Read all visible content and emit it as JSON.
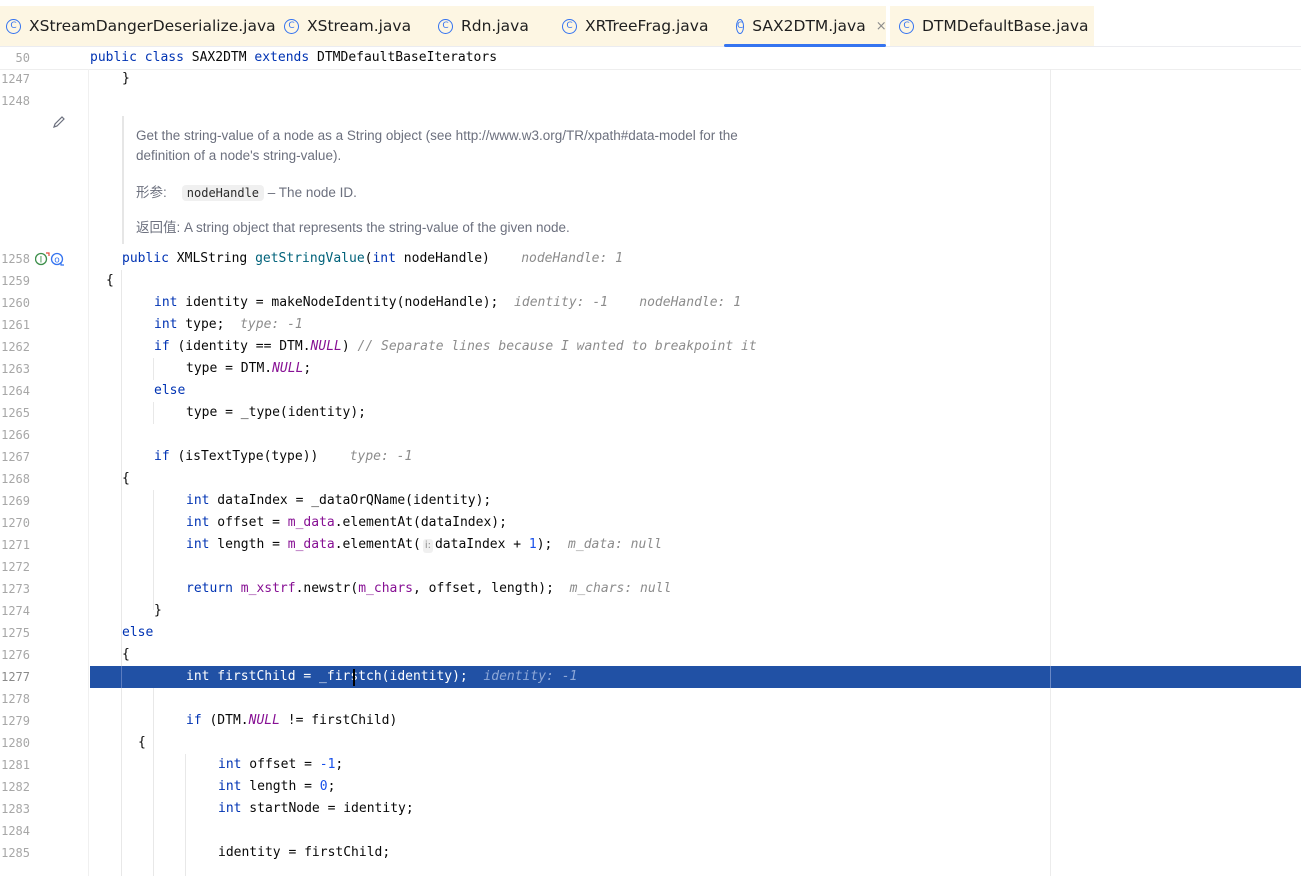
{
  "tabs": [
    {
      "label": "XStreamDangerDeserialize.java",
      "active": false
    },
    {
      "label": "XStream.java",
      "active": false
    },
    {
      "label": "Rdn.java",
      "active": false
    },
    {
      "label": "XRTreeFrag.java",
      "active": false
    },
    {
      "label": "SAX2DTM.java",
      "active": true
    },
    {
      "label": "DTMDefaultBase.java",
      "active": false
    }
  ],
  "close_glyph": "×",
  "sticky": {
    "line": "50",
    "public": "public",
    "class": "class",
    "name": "SAX2DTM",
    "extends": "extends",
    "parent": "DTMDefaultBaseIterators"
  },
  "doc": {
    "line1": "Get the string-value of a node as a String object (see http://www.w3.org/TR/xpath#data-model for the",
    "line2": "definition of a node's string-value).",
    "params_label": "形参:",
    "param_name": "nodeHandle",
    "param_desc": "– The node ID.",
    "returns_label": "返回值:",
    "returns_desc": "A string object that represents the string-value of the given node."
  },
  "lines": {
    "l1247": "1247",
    "l1248": "1248",
    "l1258": "1258",
    "l1259": "1259",
    "l1260": "1260",
    "l1261": "1261",
    "l1262": "1262",
    "l1263": "1263",
    "l1264": "1264",
    "l1265": "1265",
    "l1266": "1266",
    "l1267": "1267",
    "l1268": "1268",
    "l1269": "1269",
    "l1270": "1270",
    "l1271": "1271",
    "l1272": "1272",
    "l1273": "1273",
    "l1274": "1274",
    "l1275": "1275",
    "l1276": "1276",
    "l1277": "1277",
    "l1278": "1278",
    "l1279": "1279",
    "l1280": "1280",
    "l1281": "1281",
    "l1282": "1282",
    "l1283": "1283",
    "l1284": "1284",
    "l1285": "1285"
  },
  "code": {
    "c1247": "}",
    "c1258_pub": "public ",
    "c1258_type": "XMLString ",
    "c1258_fn": "getStringValue",
    "c1258_a": "(",
    "c1258_int": "int",
    "c1258_b": " nodeHandle)",
    "c1258_hint": "nodeHandle: 1",
    "c1259": "{",
    "c1260_int": "int",
    "c1260_a": " identity = makeNodeIdentity(nodeHandle);",
    "c1260_h1": "identity: -1",
    "c1260_h2": "nodeHandle: 1",
    "c1261_int": "int",
    "c1261_a": " type;",
    "c1261_h": "type: -1",
    "c1262_if": "if",
    "c1262_a": " (identity == DTM.",
    "c1262_null": "NULL",
    "c1262_b": ") ",
    "c1262_cmt": "// Separate lines because I wanted to breakpoint it",
    "c1263_a": "type = DTM.",
    "c1263_null": "NULL",
    "c1263_b": ";",
    "c1264": "else",
    "c1265": "type = _type(identity);",
    "c1267_if": "if",
    "c1267_a": " (isTextType(type))",
    "c1267_h": "type: -1",
    "c1268": "{",
    "c1269_int": "int",
    "c1269_a": " dataIndex = _dataOrQName(identity);",
    "c1270_int": "int",
    "c1270_a": " offset = ",
    "c1270_fld": "m_data",
    "c1270_b": ".elementAt(dataIndex);",
    "c1271_int": "int",
    "c1271_a": " length = ",
    "c1271_fld": "m_data",
    "c1271_b": ".elementAt(",
    "c1271_ph": "i:",
    "c1271_c": "dataIndex + ",
    "c1271_num": "1",
    "c1271_d": ");",
    "c1271_h": "m_data: null",
    "c1273_ret": "return",
    "c1273_a": " ",
    "c1273_f1": "m_xstrf",
    "c1273_b": ".newstr(",
    "c1273_f2": "m_chars",
    "c1273_c": ", offset, length);",
    "c1273_h": "m_chars: null",
    "c1274": "}",
    "c1275": "else",
    "c1276": "{",
    "c1277_a": "int firstChild = _firstch(identity);",
    "c1277_h": "identity: -1",
    "c1279_if": "if",
    "c1279_a": " (DTM.",
    "c1279_null": "NULL",
    "c1279_b": " != firstChild)",
    "c1280": "{",
    "c1281_int": "int",
    "c1281_a": " offset = ",
    "c1281_num": "-1",
    "c1281_b": ";",
    "c1282_int": "int",
    "c1282_a": " length = ",
    "c1282_num": "0",
    "c1282_b": ";",
    "c1283_int": "int",
    "c1283_a": " startNode = identity;",
    "c1285": "identity = firstChild;"
  },
  "colors": {
    "accent": "#3574f0",
    "selection": "#2151a5",
    "keyword": "#0033b3",
    "field": "#871094"
  }
}
